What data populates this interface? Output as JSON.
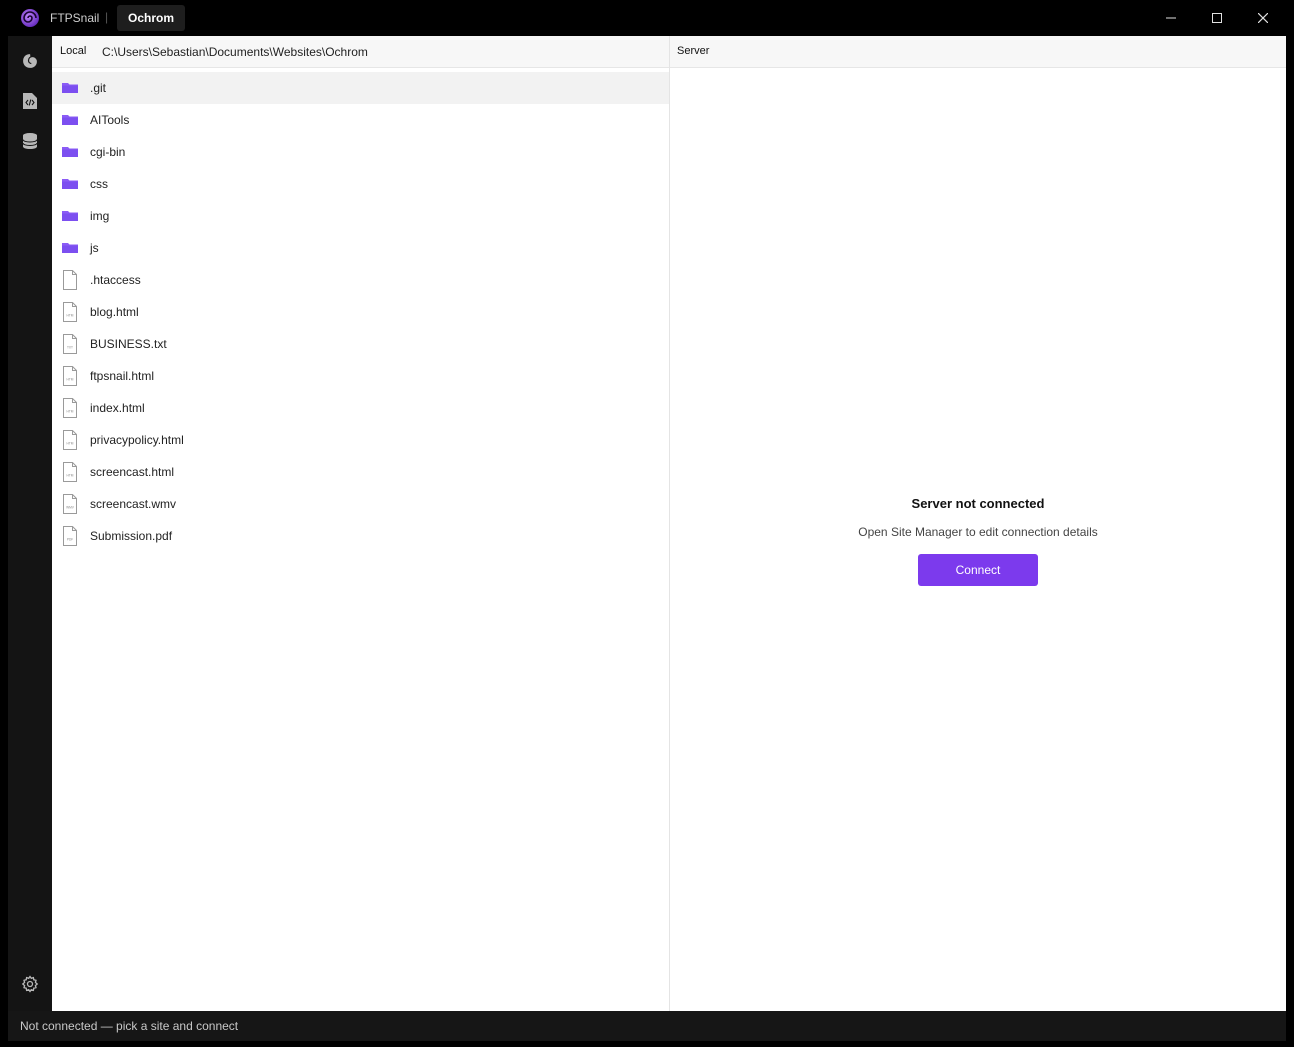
{
  "app": {
    "name": "FTPSnail",
    "separator": "|",
    "site_tab": "Ochrom"
  },
  "local": {
    "label": "Local",
    "path": "C:\\Users\\Sebastian\\Documents\\Websites\\Ochrom",
    "items": [
      {
        "name": ".git",
        "type": "folder",
        "selected": true
      },
      {
        "name": "AITools",
        "type": "folder"
      },
      {
        "name": "cgi-bin",
        "type": "folder"
      },
      {
        "name": "css",
        "type": "folder"
      },
      {
        "name": "img",
        "type": "folder"
      },
      {
        "name": "js",
        "type": "folder"
      },
      {
        "name": ".htaccess",
        "type": "file",
        "badge": ""
      },
      {
        "name": "blog.html",
        "type": "file",
        "badge": "HTM"
      },
      {
        "name": "BUSINESS.txt",
        "type": "file",
        "badge": "TXT"
      },
      {
        "name": "ftpsnail.html",
        "type": "file",
        "badge": "HTM"
      },
      {
        "name": "index.html",
        "type": "file",
        "badge": "HTM"
      },
      {
        "name": "privacypolicy.html",
        "type": "file",
        "badge": "HTM"
      },
      {
        "name": "screencast.html",
        "type": "file",
        "badge": "HTM"
      },
      {
        "name": "screencast.wmv",
        "type": "file",
        "badge": "WMV"
      },
      {
        "name": "Submission.pdf",
        "type": "file",
        "badge": "PDF"
      }
    ]
  },
  "server": {
    "label": "Server",
    "empty_title": "Server not connected",
    "empty_subtitle": "Open Site Manager to edit connection details",
    "connect_label": "Connect"
  },
  "status": {
    "text": "Not connected — pick a site and connect"
  },
  "colors": {
    "accent": "#7c3aed",
    "folder": "#8b5cf6"
  }
}
